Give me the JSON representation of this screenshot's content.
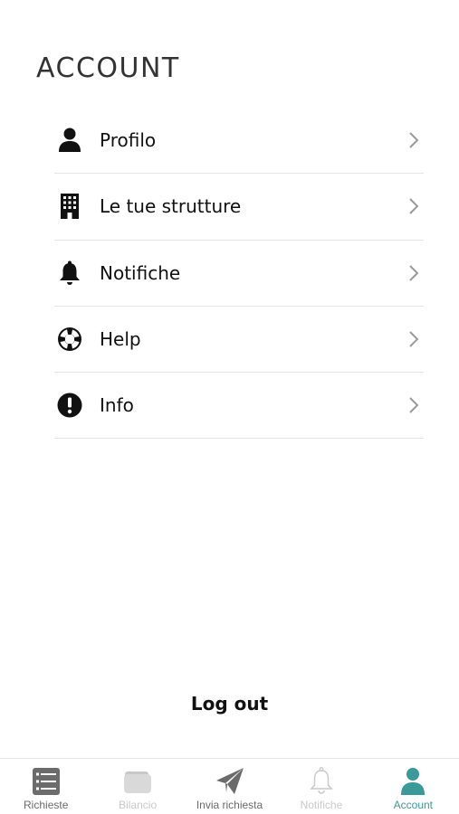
{
  "header": {
    "title": "ACCOUNT"
  },
  "menu": {
    "items": [
      {
        "label": "Profilo",
        "icon": "user-icon"
      },
      {
        "label": "Le tue strutture",
        "icon": "building-icon"
      },
      {
        "label": "Notifiche",
        "icon": "bell-icon"
      },
      {
        "label": "Help",
        "icon": "lifebuoy-icon"
      },
      {
        "label": "Info",
        "icon": "exclamation-circle-icon"
      }
    ]
  },
  "logout": {
    "label": "Log out"
  },
  "tabbar": {
    "active_color": "#3a9a9a",
    "items": [
      {
        "label": "Richieste",
        "icon": "list-icon",
        "state": "enabled"
      },
      {
        "label": "Bilancio",
        "icon": "wallet-icon",
        "state": "disabled"
      },
      {
        "label": "Invia richiesta",
        "icon": "paper-plane-icon",
        "state": "enabled"
      },
      {
        "label": "Notifiche",
        "icon": "bell-outline-icon",
        "state": "disabled"
      },
      {
        "label": "Account",
        "icon": "user-icon",
        "state": "active"
      }
    ]
  }
}
